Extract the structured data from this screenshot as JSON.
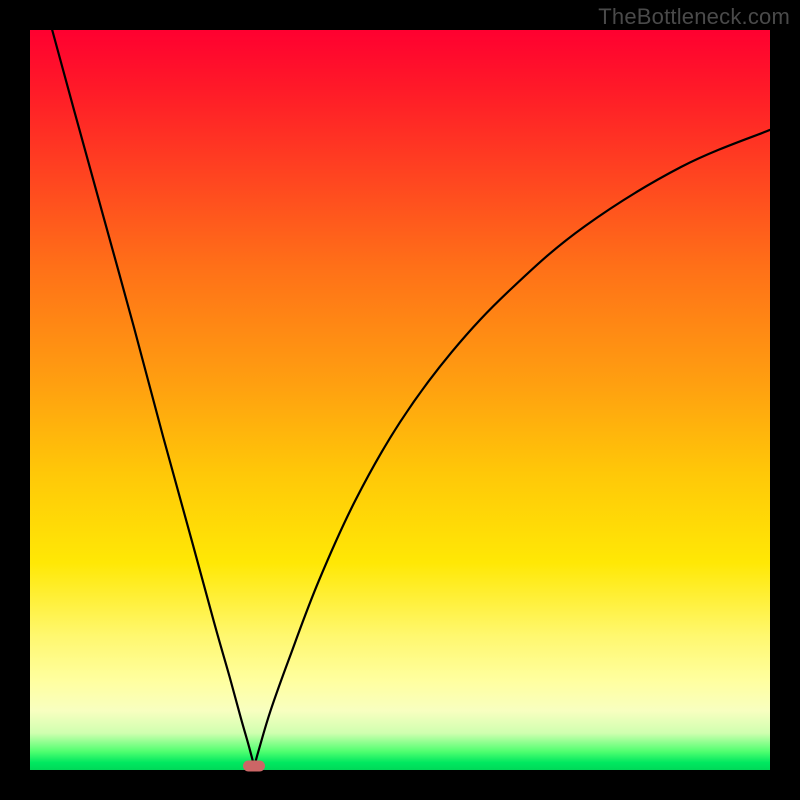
{
  "watermark": "TheBottleneck.com",
  "chart_data": {
    "type": "line",
    "title": "",
    "xlabel": "",
    "ylabel": "",
    "xlim": [
      0,
      100
    ],
    "ylim": [
      0,
      100
    ],
    "grid": false,
    "legend": false,
    "series": [
      {
        "name": "left-branch",
        "x": [
          3,
          6,
          10,
          14,
          18,
          22,
          25,
          27,
          28.5,
          29.5,
          30.3
        ],
        "y": [
          100,
          89,
          74.5,
          60,
          45,
          30.5,
          19.5,
          12.5,
          7,
          3.5,
          0.5
        ]
      },
      {
        "name": "right-branch",
        "x": [
          30.3,
          31,
          32.5,
          35,
          39,
          44,
          50,
          57,
          65,
          75,
          88,
          100
        ],
        "y": [
          0.5,
          3,
          8,
          15,
          25.5,
          36.5,
          47,
          56.5,
          65,
          73.5,
          81.5,
          86.5
        ]
      }
    ],
    "annotations": [
      {
        "name": "min-marker",
        "x": 30.3,
        "y": 0.6,
        "color": "#cc6666"
      }
    ],
    "background_gradient": {
      "direction": "vertical",
      "stops": [
        {
          "pos": 0.0,
          "color": "#ff0030"
        },
        {
          "pos": 0.5,
          "color": "#ffa010"
        },
        {
          "pos": 0.85,
          "color": "#fff870"
        },
        {
          "pos": 1.0,
          "color": "#00d858"
        }
      ]
    }
  }
}
